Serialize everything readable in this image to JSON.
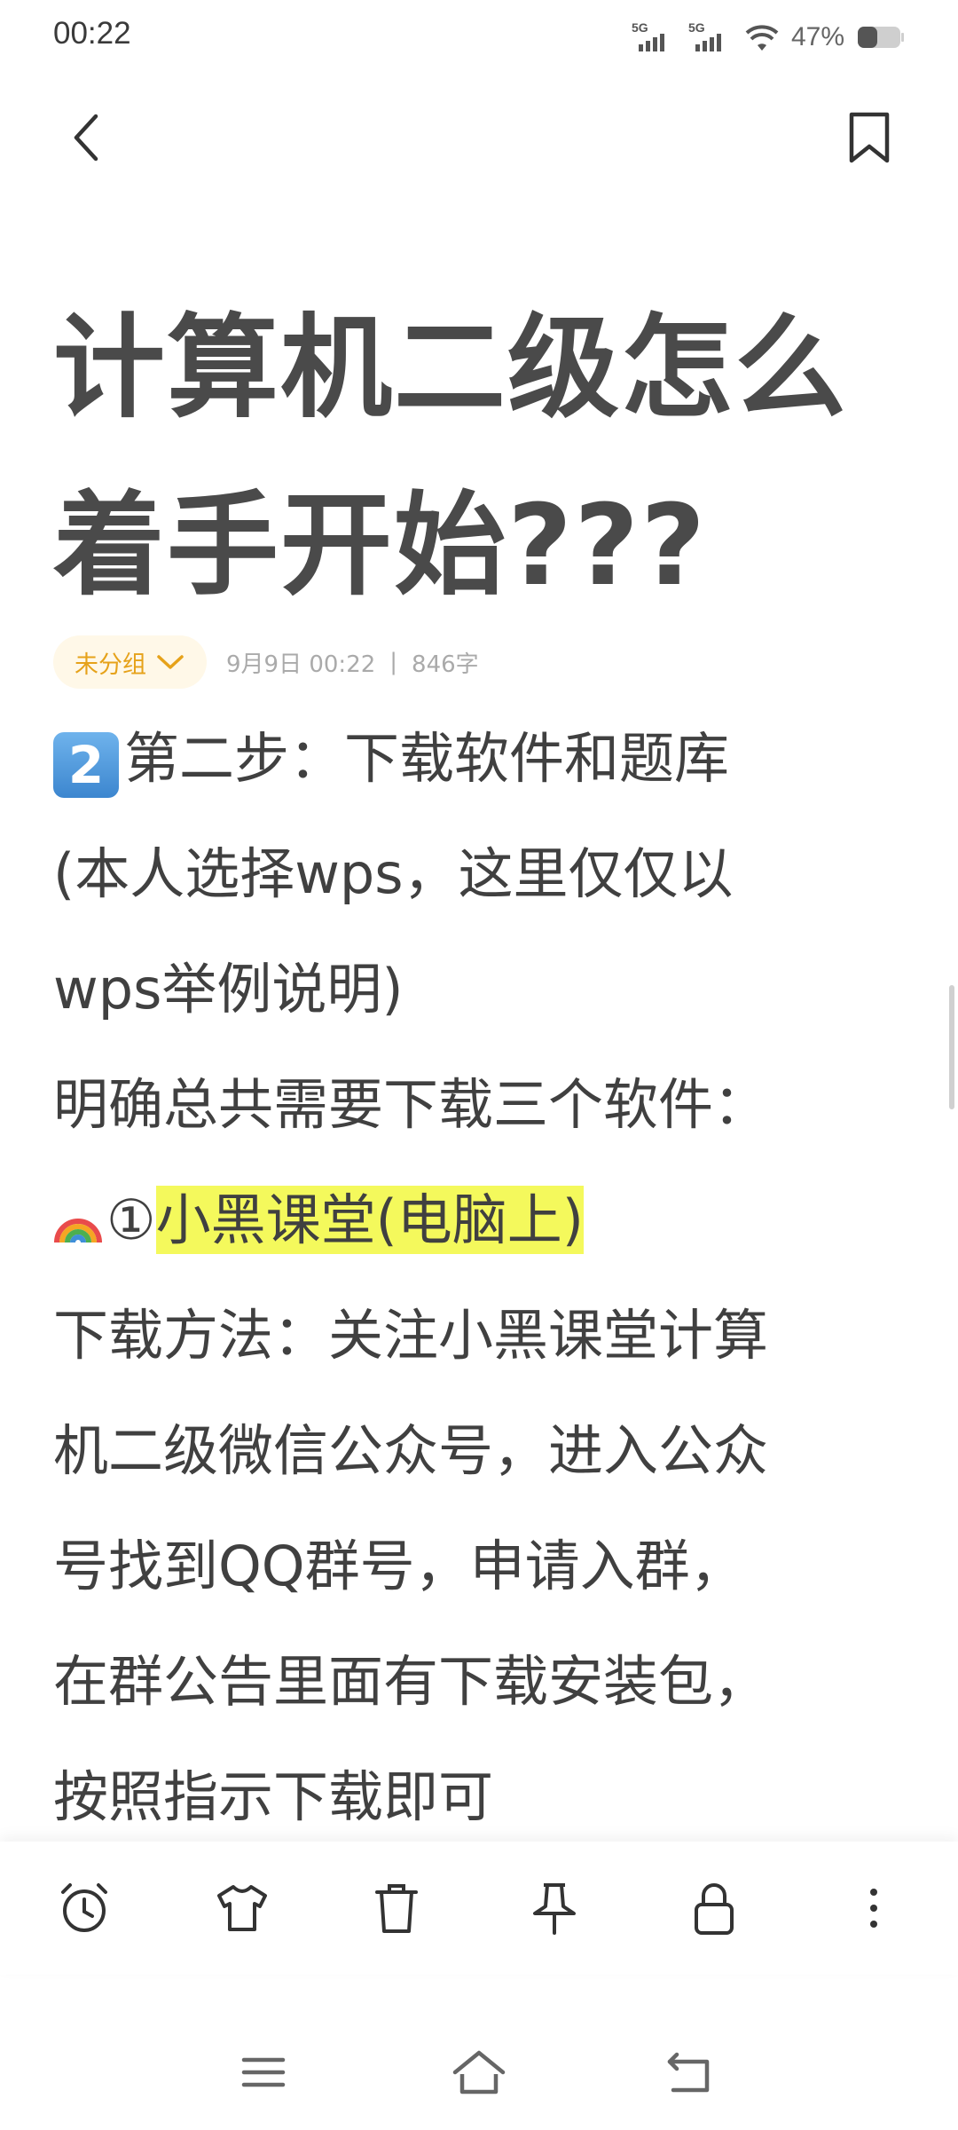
{
  "status_bar": {
    "time": "00:22",
    "signal1": "5G",
    "signal2": "5G",
    "battery": "47%"
  },
  "note": {
    "title_line1": "计算机二级怎么",
    "title_line2": "着手开始???",
    "group": "未分组",
    "date": "9月9日 00:22",
    "separator": "|",
    "word_count": "846字",
    "lines": {
      "step_emoji": "2",
      "step_text": "第二步：下载软件和题库",
      "l2": "(本人选择wps，这里仅仅以",
      "l3": "wps举例说明)",
      "l4": "明确总共需要下载三个软件：",
      "l5_num": "①",
      "l5_highlight": "小黑课堂(电脑上)",
      "l6": "下载方法：关注小黑课堂计算",
      "l7": "机二级微信公众号，进入公众",
      "l8": "号找到QQ群号，申请入群，",
      "l9": "在群公告里面有下载安装包，",
      "l10": "按照指示下载即可"
    }
  },
  "toolbar": {
    "icons": [
      "alarm-clock-icon",
      "shirt-icon",
      "trash-icon",
      "pin-icon",
      "lock-icon",
      "more-vertical-icon"
    ]
  },
  "colors": {
    "accent": "#e6a21a",
    "highlight": "#f4f95c",
    "text": "#404040"
  }
}
